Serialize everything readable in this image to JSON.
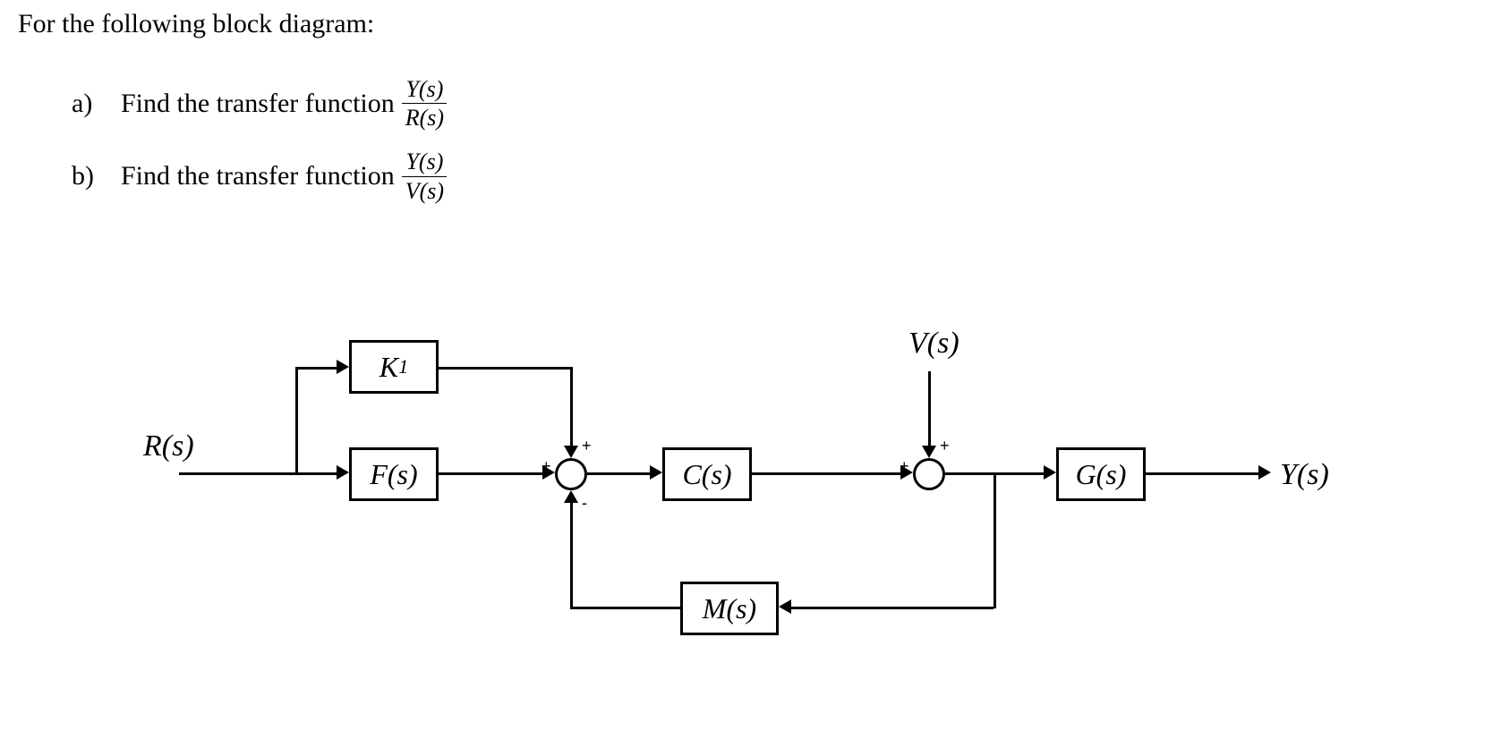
{
  "prompt": "For the following block diagram:",
  "questions": {
    "a": {
      "label": "a)",
      "text": "Find the transfer function",
      "fraction_num": "Y(s)",
      "fraction_den": "R(s)"
    },
    "b": {
      "label": "b)",
      "text": "Find the transfer function",
      "fraction_num": "Y(s)",
      "fraction_den": "V(s)"
    }
  },
  "diagram": {
    "input_signal": "R(s)",
    "disturbance_signal": "V(s)",
    "output_signal": "Y(s)",
    "blocks": {
      "K1_base": "K",
      "K1_sub": "1",
      "F": "F(s)",
      "C": "C(s)",
      "G": "G(s)",
      "M": "M(s)"
    },
    "junction1": {
      "sign_left": "+",
      "sign_top": "+",
      "sign_bottom": "-"
    },
    "junction2": {
      "sign_left": "+",
      "sign_top": "+"
    }
  }
}
